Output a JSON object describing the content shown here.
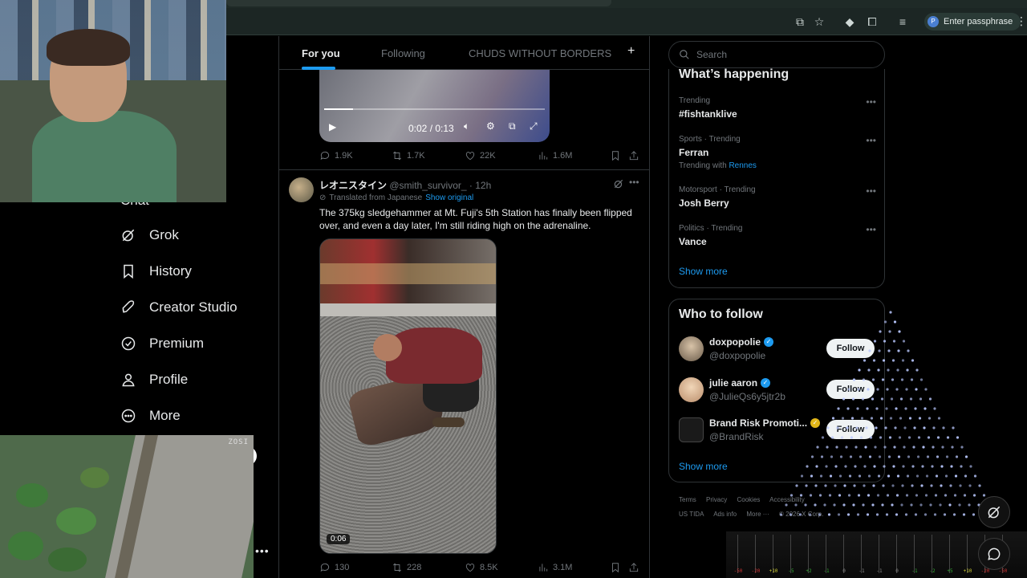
{
  "browser": {
    "passphrase_label": "Enter passphrase",
    "profile_initial": "P"
  },
  "nav": {
    "partial_label": "Chat",
    "items": [
      {
        "label": "Grok",
        "icon": "grok-icon"
      },
      {
        "label": "History",
        "icon": "bookmark-icon"
      },
      {
        "label": "Creator Studio",
        "icon": "rocket-icon"
      },
      {
        "label": "Premium",
        "icon": "premium-icon"
      },
      {
        "label": "Profile",
        "icon": "profile-icon"
      },
      {
        "label": "More",
        "icon": "more-circle-icon"
      }
    ],
    "more_dots": "•••"
  },
  "timeline": {
    "tabs": [
      "For you",
      "Following",
      "CHUDS WITHOUT BORDERS"
    ],
    "add_tab": "+",
    "post1": {
      "video_time": "0:02 / 0:13",
      "replies": "1.9K",
      "reposts": "1.7K",
      "likes": "22K",
      "views": "1.6M"
    },
    "post2": {
      "name": "レオニスタイン",
      "handle": "@smith_survivor_",
      "time": "· 12h",
      "translated": "Translated from Japanese",
      "show_original": "Show original",
      "text": "The 375kg sledgehammer at Mt. Fuji's 5th Station has finally been flipped over, and even a day later, I'm still riding high on the adrenaline.",
      "duration": "0:06",
      "replies": "130",
      "reposts": "228",
      "likes": "8.5K",
      "views": "3.1M"
    }
  },
  "search": {
    "placeholder": "Search"
  },
  "happening": {
    "title": "What’s happening",
    "trends": [
      {
        "context": "Trending",
        "topic": "#fishtanklive"
      },
      {
        "context": "Sports · Trending",
        "topic": "Ferran",
        "with_prefix": "Trending with",
        "with_link": "Rennes"
      },
      {
        "context": "Motorsport · Trending",
        "topic": "Josh Berry"
      },
      {
        "context": "Politics · Trending",
        "topic": "Vance"
      }
    ],
    "show_more": "Show more"
  },
  "who_to_follow": {
    "title": "Who to follow",
    "accounts": [
      {
        "name": "doxpopolie",
        "handle": "@doxpopolie",
        "badge_color": "#1d9bf0"
      },
      {
        "name": "julie aaron",
        "handle": "@JulieQs6y5jtr2b",
        "badge_color": "#1d9bf0"
      },
      {
        "name": "Brand Risk Promoti...",
        "handle": "@BrandRisk",
        "badge_color": "#e2b719"
      }
    ],
    "follow_label": "Follow",
    "show_more": "Show more"
  },
  "footer": {
    "row1": [
      "Terms",
      "Privacy",
      "Cookies",
      "Accessibility"
    ],
    "row2": [
      "US TIDA",
      "Ads info",
      "More ···",
      "© 2026 X Corp."
    ]
  },
  "mixer": {
    "labels": [
      "-50",
      "-20",
      "+10",
      "-5",
      "+2",
      "-1",
      "0",
      "-1",
      "-1",
      "0",
      "-1",
      "-2",
      "+5",
      "+10",
      "-20",
      "-50"
    ]
  },
  "cctv": {
    "brand": "ZOSI"
  },
  "colors": {
    "accent": "#1d9bf0",
    "gold_badge": "#e2b719"
  }
}
